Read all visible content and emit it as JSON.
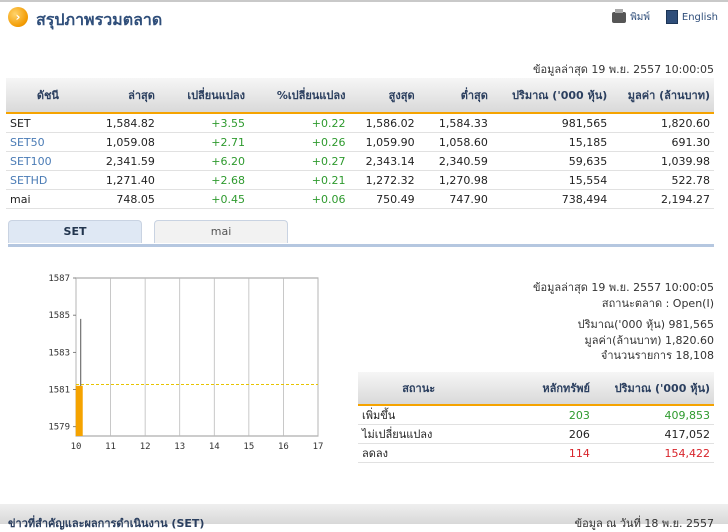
{
  "header": {
    "title": "สรุปภาพรวมตลาด",
    "print_label": "พิมพ์",
    "lang_label": "English"
  },
  "updated_top": "ข้อมูลล่าสุด 19 พ.ย. 2557 10:00:05",
  "index_table": {
    "columns": [
      "ดัชนี",
      "ล่าสุด",
      "เปลี่ยนแปลง",
      "%เปลี่ยนแปลง",
      "สูงสุด",
      "ต่ำสุด",
      "ปริมาณ ('000 หุ้น)",
      "มูลค่า (ล้านบาท)"
    ],
    "rows": [
      [
        "SET",
        "1,584.82",
        "+3.55",
        "+0.22",
        "1,586.02",
        "1,584.33",
        "981,565",
        "1,820.60"
      ],
      [
        "SET50",
        "1,059.08",
        "+2.71",
        "+0.26",
        "1,059.90",
        "1,058.60",
        "15,185",
        "691.30"
      ],
      [
        "SET100",
        "2,341.59",
        "+6.20",
        "+0.27",
        "2,343.14",
        "2,340.59",
        "59,635",
        "1,039.98"
      ],
      [
        "SETHD",
        "1,271.40",
        "+2.68",
        "+0.21",
        "1,272.32",
        "1,270.98",
        "15,554",
        "522.78"
      ],
      [
        "mai",
        "748.05",
        "+0.45",
        "+0.06",
        "750.49",
        "747.90",
        "738,494",
        "2,194.27"
      ]
    ]
  },
  "tabs": [
    "SET",
    "mai"
  ],
  "chart_data": {
    "type": "bar",
    "x_ticks": [
      "10",
      "11",
      "12",
      "13",
      "14",
      "15",
      "16",
      "17"
    ],
    "y_ticks": [
      "1587",
      "1585",
      "1583",
      "1581",
      "1579"
    ],
    "ylim": [
      1578.5,
      1587
    ],
    "bars": [
      {
        "x": 10.05,
        "open": 1581.2,
        "close": 1578.5,
        "high": 1584.8,
        "low": 1578.5
      }
    ],
    "reference_line": 1581.27,
    "colors": {
      "bar": "#f5a300",
      "ref": "#e8c400",
      "grid": "#bbbbbb"
    }
  },
  "info": {
    "updated": "ข้อมูลล่าสุด 19 พ.ย. 2557 10:00:05",
    "status": "สถานะตลาด : Open(I)",
    "volume": "ปริมาณ('000 หุ้น) 981,565",
    "value": "มูลค่า(ล้านบาท) 1,820.60",
    "deals": "จำนวนรายการ 18,108"
  },
  "stat_table": {
    "columns": [
      "สถานะ",
      "หลักทรัพย์",
      "ปริมาณ ('000 หุ้น)"
    ],
    "rows": [
      {
        "label": "เพิ่มขึ้น",
        "count": "203",
        "volume": "409,853",
        "color": "green"
      },
      {
        "label": "ไม่เปลี่ยนแปลง",
        "count": "206",
        "volume": "417,052",
        "color": "black"
      },
      {
        "label": "ลดลง",
        "count": "114",
        "volume": "154,422",
        "color": "red"
      }
    ]
  },
  "footer": {
    "left": "ข่าวที่สำคัญและผลการดำเนินงาน (SET)",
    "right": "ข้อมูล ณ วันที่ 18 พ.ย. 2557"
  }
}
